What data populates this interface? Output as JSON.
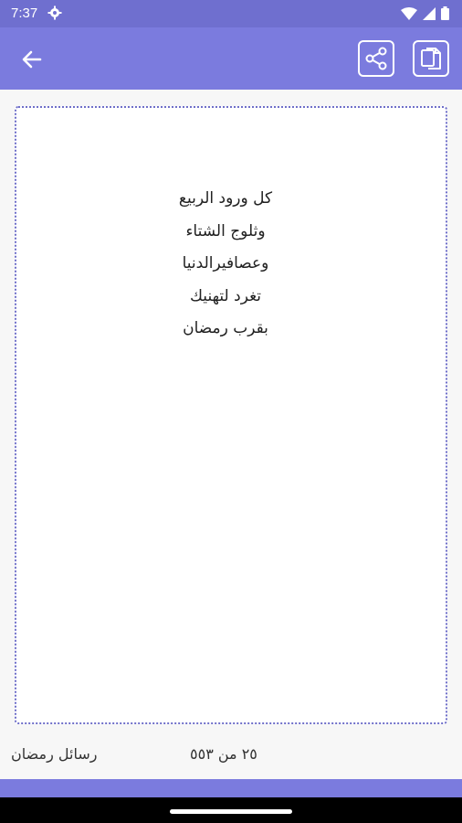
{
  "status_bar": {
    "time": "7:37",
    "icons": [
      "settings-gear-icon",
      "wifi-icon",
      "signal-icon",
      "battery-icon"
    ]
  },
  "app_bar": {
    "icons": [
      "back-arrow-icon",
      "share-icon",
      "copy-icon"
    ],
    "accent": "#7b7bde"
  },
  "message": {
    "lines": [
      "كل ورود الربيع",
      "وثلوج الشتاء",
      "وعصافيرالدنيا",
      "تغرد لتهنيك",
      "بقرب رمضان"
    ]
  },
  "footer": {
    "category": "رسائل رمضان",
    "counter": "٢٥ من ٥٥٣"
  },
  "colors": {
    "status_bar": "#6f6fcf",
    "app_bar": "#7b7bde",
    "card_border": "#6f6fc9",
    "background": "#f7f7f7"
  }
}
